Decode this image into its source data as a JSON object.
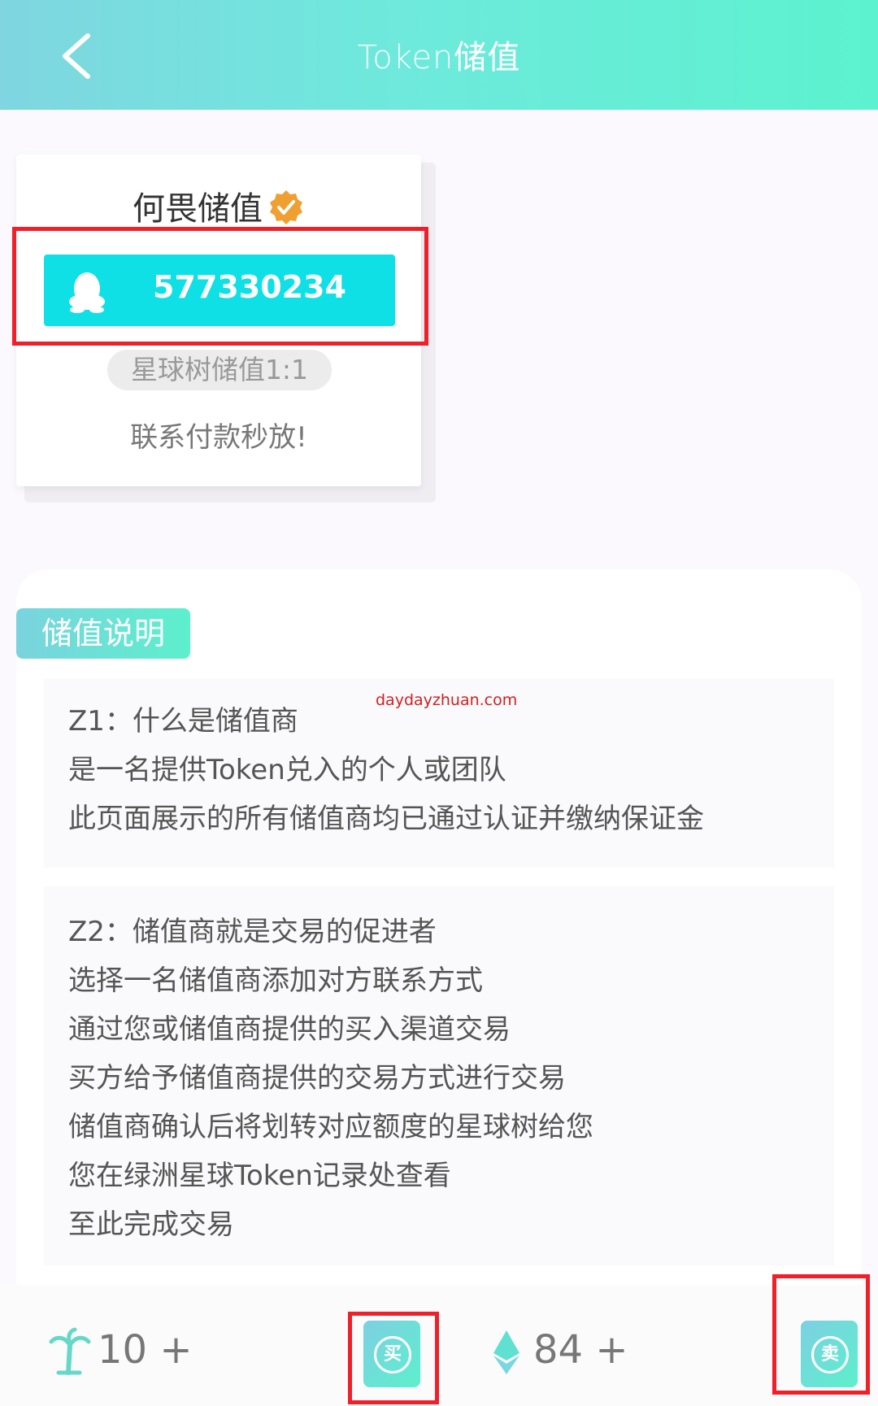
{
  "header": {
    "title_part1": "Token",
    "title_part2": "储值"
  },
  "merchant": {
    "name": "何畏储值",
    "qq_number": "577330234",
    "rate_text": "星球树储值1:1",
    "note": "联系付款秒放!"
  },
  "section": {
    "title": "储值说明"
  },
  "watermark": "daydayzhuan.com",
  "faq": [
    {
      "lines": [
        "Z1：什么是储值商",
        "是一名提供Token兑入的个人或团队",
        "此页面展示的所有储值商均已通过认证并缴纳保证金"
      ]
    },
    {
      "lines": [
        "Z2：储值商就是交易的促进者",
        "选择一名储值商添加对方联系方式",
        "通过您或储值商提供的买入渠道交易",
        "买方给予储值商提供的交易方式进行交易",
        "储值商确认后将划转对应额度的星球树给您",
        "您在绿洲星球Token记录处查看",
        "至此完成交易"
      ]
    }
  ],
  "bottom": {
    "tree_balance": "10 +",
    "buy_label": "买",
    "eth_balance": "84 +",
    "sell_label": "卖"
  },
  "colors": {
    "accent": "#0ee0e6",
    "highlight_box": "#f0202a",
    "verified": "#f0a030"
  }
}
